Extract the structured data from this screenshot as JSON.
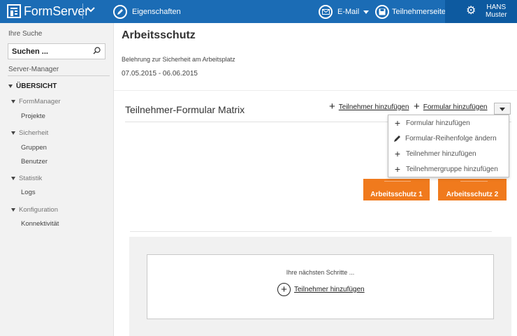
{
  "topbar": {
    "app_name": "FormServer",
    "properties_label": "Eigenschaften",
    "email_label": "E-Mail",
    "participant_page_label": "Teilnehmerseite",
    "user_first": "HANS",
    "user_last": "Muster",
    "icons": [
      "pencil-icon",
      "mail-icon",
      "save-icon",
      "gear-icon",
      "chevron-down-icon"
    ]
  },
  "sidebar": {
    "search_label": "Ihre Suche",
    "search_placeholder": "Suchen ...",
    "server_manager_label": "Server-Manager",
    "overview_label": "ÜBERSICHT",
    "groups": [
      {
        "label": "FormManager",
        "items": [
          "Projekte"
        ]
      },
      {
        "label": "Sicherheit",
        "items": [
          "Gruppen",
          "Benutzer"
        ]
      },
      {
        "label": "Statistik",
        "items": [
          "Logs"
        ]
      },
      {
        "label": "Konfiguration",
        "items": [
          "Konnektivität"
        ]
      }
    ]
  },
  "page": {
    "title": "Arbeitsschutz",
    "subtitle": "Belehrung zur Sicherheit am Arbeitsplatz",
    "dates": "07.05.2015 - 06.06.2015"
  },
  "matrix": {
    "title": "Teilnehmer-Formular Matrix",
    "add_participant_label": "Teilnehmer hinzufügen",
    "add_form_label": "Formular hinzufügen"
  },
  "menu": {
    "items": [
      {
        "label": "Formular hinzufügen",
        "icon": "plus-icon"
      },
      {
        "label": "Formular-Reihenfolge ändern",
        "icon": "pencil-icon"
      },
      {
        "label": "Teilnehmer hinzufügen",
        "icon": "plus-icon"
      },
      {
        "label": "Teilnehmergruppe hinzufügen",
        "icon": "plus-icon"
      }
    ]
  },
  "tiles": [
    {
      "label": "Arbeitsschutz 1"
    },
    {
      "label": "Arbeitsschutz 2"
    }
  ],
  "next_steps": {
    "title": "Ihre nächsten Schritte ...",
    "add_participant_label": "Teilnehmer hinzufügen"
  },
  "colors": {
    "topbar": "#1b6cb5",
    "user_area": "#0d5aa0",
    "tile": "#f07a1d"
  }
}
